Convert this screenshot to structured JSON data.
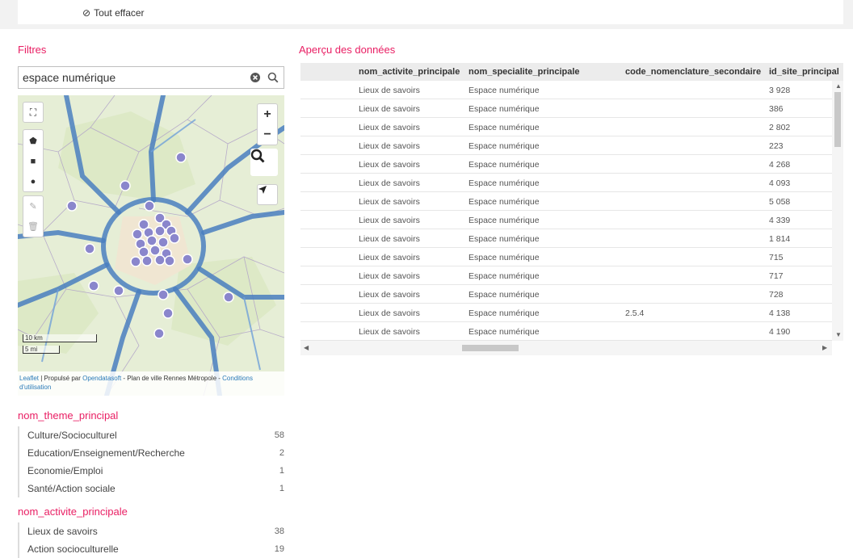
{
  "topbar": {
    "clear_all_label": "Tout effacer"
  },
  "filters": {
    "title": "Filtres",
    "search_value": "espace numérique"
  },
  "map": {
    "attribution": {
      "leaflet": "Leaflet",
      "middle": " | Propulsé par ",
      "opendatasoft": "Opendatasoft",
      "plan": " - Plan de ville Rennes Métropole - ",
      "conditions": "Conditions d'utilisation"
    },
    "scale_km": "10 km",
    "scale_mi": "5 mi"
  },
  "facets": [
    {
      "title": "nom_theme_principal",
      "items": [
        {
          "label": "Culture/Socioculturel",
          "count": "58"
        },
        {
          "label": "Education/Enseignement/Recherche",
          "count": "2"
        },
        {
          "label": "Economie/Emploi",
          "count": "1"
        },
        {
          "label": "Santé/Action sociale",
          "count": "1"
        }
      ]
    },
    {
      "title": "nom_activite_principale",
      "items": [
        {
          "label": "Lieux de savoirs",
          "count": "38"
        },
        {
          "label": "Action socioculturelle",
          "count": "19"
        }
      ]
    }
  ],
  "preview": {
    "title": "Aperçu des données",
    "columns": [
      "nom_activite_principale",
      "nom_specialite_principale",
      "code_nomenclature_secondaire",
      "id_site_principal"
    ],
    "rows": [
      [
        "Lieux de savoirs",
        "Espace numérique",
        "",
        "3 928"
      ],
      [
        "Lieux de savoirs",
        "Espace numérique",
        "",
        "386"
      ],
      [
        "Lieux de savoirs",
        "Espace numérique",
        "",
        "2 802"
      ],
      [
        "Lieux de savoirs",
        "Espace numérique",
        "",
        "223"
      ],
      [
        "Lieux de savoirs",
        "Espace numérique",
        "",
        "4 268"
      ],
      [
        "Lieux de savoirs",
        "Espace numérique",
        "",
        "4 093"
      ],
      [
        "Lieux de savoirs",
        "Espace numérique",
        "",
        "5 058"
      ],
      [
        "Lieux de savoirs",
        "Espace numérique",
        "",
        "4 339"
      ],
      [
        "Lieux de savoirs",
        "Espace numérique",
        "",
        "1 814"
      ],
      [
        "Lieux de savoirs",
        "Espace numérique",
        "",
        "715"
      ],
      [
        "Lieux de savoirs",
        "Espace numérique",
        "",
        "717"
      ],
      [
        "Lieux de savoirs",
        "Espace numérique",
        "",
        "728"
      ],
      [
        "Lieux de savoirs",
        "Espace numérique",
        "2.5.4",
        "4 138"
      ],
      [
        "Lieux de savoirs",
        "Espace numérique",
        "",
        "4 190"
      ]
    ]
  },
  "colors": {
    "accent": "#e91e63",
    "marker": "#8a86cc",
    "road": "#4a7fc0",
    "link": "#2a7ab8"
  }
}
